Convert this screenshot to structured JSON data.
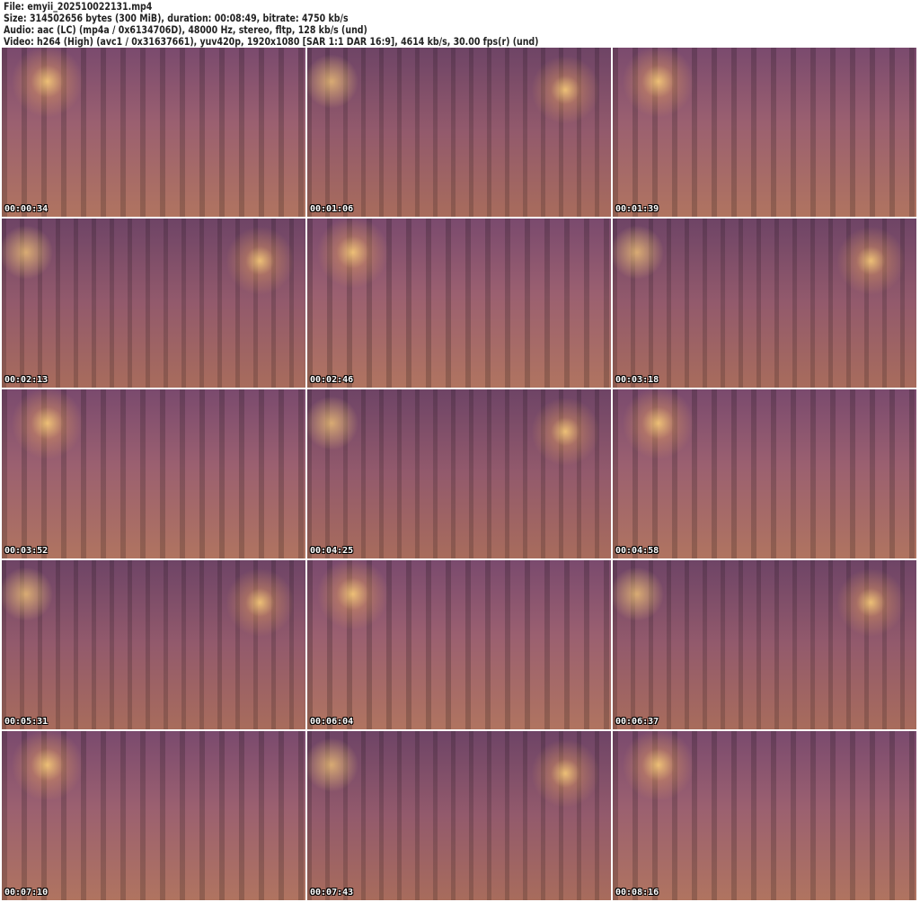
{
  "header": {
    "file": "File: emyii_202510022131.mp4",
    "size": "Size: 314502656 bytes (300 MiB), duration: 00:08:49, bitrate: 4750 kb/s",
    "audio": "Audio: aac (LC) (mp4a / 0x6134706D), 48000 Hz, stereo, fltp, 128 kb/s (und)",
    "video": "Video: h264 (High) (avc1 / 0x31637661), yuv420p, 1920x1080 [SAR 1:1 DAR 16:9], 4614 kb/s, 30.00 fps(r) (und)"
  },
  "thumbnails": [
    {
      "time": "00:00:34"
    },
    {
      "time": "00:01:06"
    },
    {
      "time": "00:01:39"
    },
    {
      "time": "00:02:13"
    },
    {
      "time": "00:02:46"
    },
    {
      "time": "00:03:18"
    },
    {
      "time": "00:03:52"
    },
    {
      "time": "00:04:25"
    },
    {
      "time": "00:04:58"
    },
    {
      "time": "00:05:31"
    },
    {
      "time": "00:06:04"
    },
    {
      "time": "00:06:37"
    },
    {
      "time": "00:07:10"
    },
    {
      "time": "00:07:43"
    },
    {
      "time": "00:08:16"
    }
  ]
}
